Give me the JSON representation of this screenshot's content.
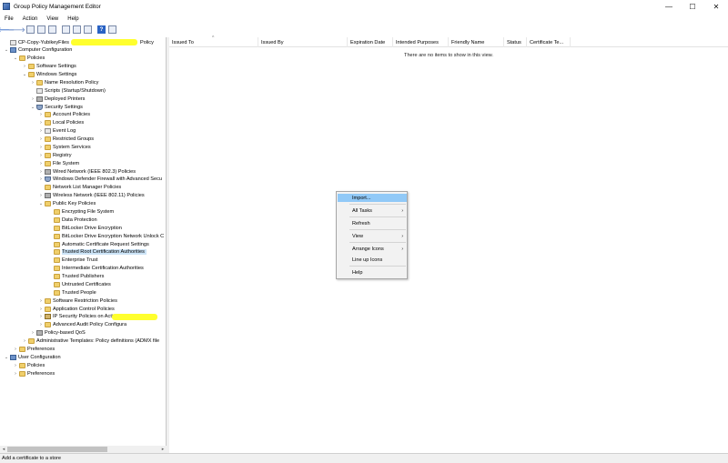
{
  "window": {
    "title": "Group Policy Management Editor",
    "controls": [
      "—",
      "☐",
      "✕"
    ]
  },
  "menu": [
    "File",
    "Action",
    "View",
    "Help"
  ],
  "toolbar": {
    "back": "🡐",
    "forward": "🡒",
    "help": "?"
  },
  "tree": [
    {
      "label": "CP-Copy-YubikeyFiles",
      "suffix": "Policy",
      "icon": "doc",
      "twisty": "",
      "depth": 0,
      "highlight": true
    },
    {
      "label": "Computer Configuration",
      "icon": "computer",
      "twisty": "⌄",
      "depth": 0
    },
    {
      "label": "Policies",
      "icon": "folder",
      "twisty": "⌄",
      "depth": 1
    },
    {
      "label": "Software Settings",
      "icon": "folder",
      "twisty": "›",
      "depth": 2
    },
    {
      "label": "Windows Settings",
      "icon": "folder",
      "twisty": "⌄",
      "depth": 2
    },
    {
      "label": "Name Resolution Policy",
      "icon": "folder",
      "twisty": "›",
      "depth": 3
    },
    {
      "label": "Scripts (Startup/Shutdown)",
      "icon": "doc",
      "twisty": "",
      "depth": 3
    },
    {
      "label": "Deployed Printers",
      "icon": "net",
      "twisty": "›",
      "depth": 3
    },
    {
      "label": "Security Settings",
      "icon": "shield",
      "twisty": "⌄",
      "depth": 3
    },
    {
      "label": "Account Policies",
      "icon": "folder",
      "twisty": "›",
      "depth": 4
    },
    {
      "label": "Local Policies",
      "icon": "folder",
      "twisty": "›",
      "depth": 4
    },
    {
      "label": "Event Log",
      "icon": "doc",
      "twisty": "›",
      "depth": 4
    },
    {
      "label": "Restricted Groups",
      "icon": "folder",
      "twisty": "›",
      "depth": 4
    },
    {
      "label": "System Services",
      "icon": "folder",
      "twisty": "›",
      "depth": 4
    },
    {
      "label": "Registry",
      "icon": "folder",
      "twisty": "›",
      "depth": 4
    },
    {
      "label": "File System",
      "icon": "folder",
      "twisty": "›",
      "depth": 4
    },
    {
      "label": "Wired Network (IEEE 802.3) Policies",
      "icon": "net",
      "twisty": "›",
      "depth": 4
    },
    {
      "label": "Windows Defender Firewall with Advanced Secu",
      "icon": "shield",
      "twisty": "›",
      "depth": 4
    },
    {
      "label": "Network List Manager Policies",
      "icon": "folder",
      "twisty": "",
      "depth": 4
    },
    {
      "label": "Wireless Network (IEEE 802.11) Policies",
      "icon": "net",
      "twisty": "›",
      "depth": 4
    },
    {
      "label": "Public Key Policies",
      "icon": "folder",
      "twisty": "⌄",
      "depth": 4
    },
    {
      "label": "Encrypting File System",
      "icon": "folder",
      "twisty": "",
      "depth": 5
    },
    {
      "label": "Data Protection",
      "icon": "folder",
      "twisty": "",
      "depth": 5
    },
    {
      "label": "BitLocker Drive Encryption",
      "icon": "folder",
      "twisty": "",
      "depth": 5
    },
    {
      "label": "BitLocker Drive Encryption Network Unlock C",
      "icon": "folder",
      "twisty": "",
      "depth": 5
    },
    {
      "label": "Automatic Certificate Request Settings",
      "icon": "folder",
      "twisty": "",
      "depth": 5
    },
    {
      "label": "Trusted Root Certification Authorities",
      "icon": "folder",
      "twisty": "",
      "depth": 5,
      "selected": true
    },
    {
      "label": "Enterprise Trust",
      "icon": "folder",
      "twisty": "",
      "depth": 5
    },
    {
      "label": "Intermediate Certification Authorities",
      "icon": "folder",
      "twisty": "",
      "depth": 5
    },
    {
      "label": "Trusted Publishers",
      "icon": "folder",
      "twisty": "",
      "depth": 5
    },
    {
      "label": "Untrusted Certificates",
      "icon": "folder",
      "twisty": "",
      "depth": 5
    },
    {
      "label": "Trusted People",
      "icon": "folder",
      "twisty": "",
      "depth": 5
    },
    {
      "label": "Software Restriction Policies",
      "icon": "folder",
      "twisty": "›",
      "depth": 4
    },
    {
      "label": "Application Control Policies",
      "icon": "folder",
      "twisty": "›",
      "depth": 4
    },
    {
      "label": "IP Security Policies on Activ",
      "icon": "lock",
      "twisty": "›",
      "depth": 4,
      "highlight2": true
    },
    {
      "label": "Advanced Audit Policy Configura",
      "icon": "folder",
      "twisty": "›",
      "depth": 4
    },
    {
      "label": "Policy-based QoS",
      "icon": "net",
      "twisty": "›",
      "depth": 3
    },
    {
      "label": "Administrative Templates: Policy definitions (ADMX file",
      "icon": "folder",
      "twisty": "›",
      "depth": 2
    },
    {
      "label": "Preferences",
      "icon": "folder",
      "twisty": "›",
      "depth": 1
    },
    {
      "label": "User Configuration",
      "icon": "computer",
      "twisty": "⌄",
      "depth": 0
    },
    {
      "label": "Policies",
      "icon": "folder",
      "twisty": "›",
      "depth": 1
    },
    {
      "label": "Preferences",
      "icon": "folder",
      "twisty": "›",
      "depth": 1
    }
  ],
  "list": {
    "columns": [
      "Issued To",
      "Issued By",
      "Expiration Date",
      "Intended Purposes",
      "Friendly Name",
      "Status",
      "Certificate Te..."
    ],
    "empty_message": "There are no items to show in this view."
  },
  "context_menu": [
    {
      "label": "Import...",
      "hover": true
    },
    {
      "label": "All Tasks",
      "submenu": true
    },
    {
      "label": "Refresh"
    },
    {
      "label": "View",
      "submenu": true
    },
    {
      "label": "Arrange Icons",
      "submenu": true
    },
    {
      "label": "Line up Icons"
    },
    {
      "label": "Help"
    }
  ],
  "status_text": "Add a certificate to a store"
}
